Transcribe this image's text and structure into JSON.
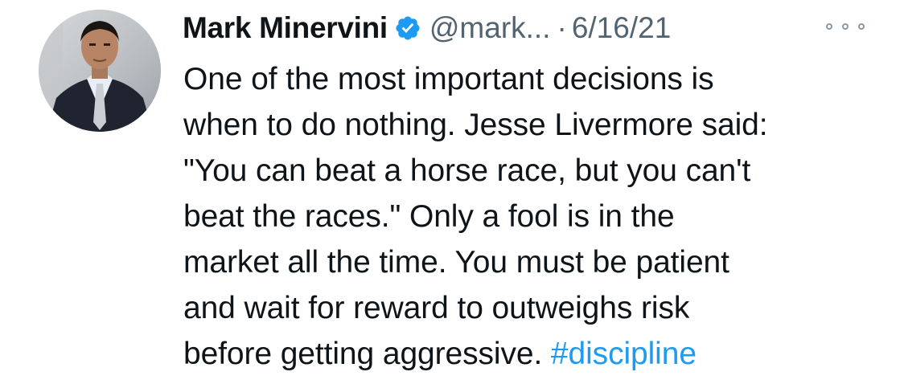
{
  "tweet": {
    "author": {
      "display_name": "Mark Minervini",
      "handle": "@mark...",
      "verified": true,
      "avatar_icon": "profile-photo"
    },
    "separator": "·",
    "date": "6/16/21",
    "more_icon": "ellipsis-icon",
    "text_lines": [
      "One of the most important decisions is",
      "when to do nothing. Jesse Livermore said:",
      "\"You can beat a horse race, but you can't",
      "beat the races.\" Only a fool is in the",
      "market all the time. You must be patient",
      "and wait for reward to outweighs risk",
      "before getting aggressive. "
    ],
    "hashtag": "#discipline"
  },
  "colors": {
    "text": "#0f1419",
    "secondary": "#536471",
    "link": "#1d9bf0",
    "verified": "#1d9bf0"
  }
}
